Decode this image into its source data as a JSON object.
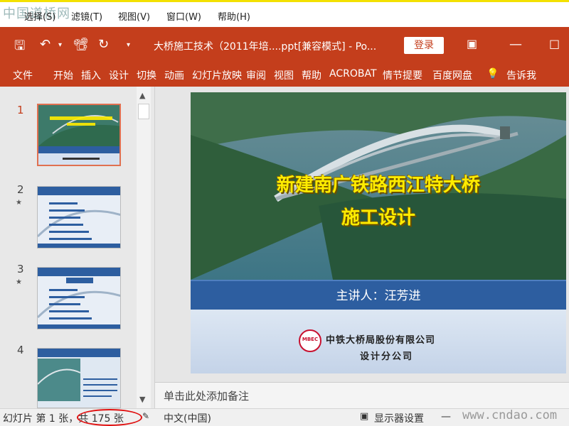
{
  "host_menu": {
    "watermark": "中国道桥网",
    "items": [
      "选择(S)",
      "滤镜(T)",
      "视图(V)",
      "窗口(W)",
      "帮助(H)"
    ]
  },
  "titlebar": {
    "title": "大桥施工技术（2011年培....ppt[兼容模式]  -  Po...",
    "login": "登录"
  },
  "ribbon": {
    "tabs": [
      "文件",
      "开始",
      "插入",
      "设计",
      "切换",
      "动画",
      "幻灯片放映",
      "审阅",
      "视图",
      "帮助",
      "ACROBAT",
      "情节提要",
      "百度网盘",
      "告诉我"
    ]
  },
  "thumbs": [
    {
      "num": "1",
      "active": true
    },
    {
      "num": "2",
      "star": "★",
      "title": "新建南广铁路西江特大桥施工设计"
    },
    {
      "num": "3",
      "star": "★",
      "title": "目 录"
    },
    {
      "num": "4",
      "title": "一、工程概况"
    }
  ],
  "slide": {
    "title_line1": "新建南广铁路西江特大桥",
    "title_line2": "施工设计",
    "presenter": "主讲人：汪芳进",
    "logo_text": "MBEC",
    "company": "中铁大桥局股份有限公司",
    "division": "设计分公司"
  },
  "notes": {
    "placeholder": "单击此处添加备注"
  },
  "status": {
    "slide_info": "幻灯片 第 1 张，共 175 张",
    "language": "中文(中国)",
    "display_settings": "显示器设置",
    "watermark": "www.cndao.com"
  },
  "colors": {
    "accent": "#c43e1c",
    "slide_title": "#ffec00",
    "band": "#2d5ea0"
  }
}
